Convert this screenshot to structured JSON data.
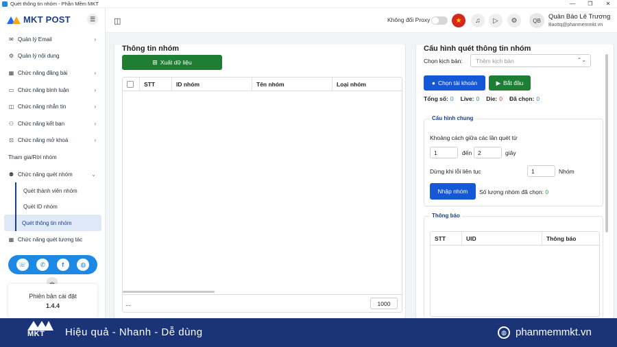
{
  "window": {
    "title": "Quét thông tin nhóm - Phần Mềm MKT",
    "minimize": "—",
    "maximize": "❐",
    "close": "✕"
  },
  "brand": {
    "logo_text": "MKT POST"
  },
  "sidebar": {
    "items": [
      {
        "label": "Quản lý Email",
        "icon": "email-icon",
        "glyph": "✉",
        "chevron": "›"
      },
      {
        "label": "Quản lý nội dung",
        "icon": "content-icon",
        "glyph": "⚙",
        "chevron": ""
      },
      {
        "label": "Chức năng đăng bài",
        "icon": "post-icon",
        "glyph": "▦",
        "chevron": "›"
      },
      {
        "label": "Chức năng bình luận",
        "icon": "comment-icon",
        "glyph": "▭",
        "chevron": "›"
      },
      {
        "label": "Chức năng nhắn tin",
        "icon": "message-icon",
        "glyph": "◫",
        "chevron": "›"
      },
      {
        "label": "Chức năng kết bạn",
        "icon": "add-friend-icon",
        "glyph": "⚇",
        "chevron": "›"
      },
      {
        "label": "Chức năng mở khoá",
        "icon": "unlock-icon",
        "glyph": "⊡",
        "chevron": "›"
      }
    ],
    "join_leave": "Tham gia/Rời nhóm",
    "scan_group": {
      "label": "Chức năng quét nhóm",
      "glyph": "⚉",
      "chevron": "⌄"
    },
    "sub_items": [
      "Quét thành viên nhóm",
      "Quét ID nhóm",
      "Quét thông tin nhóm"
    ],
    "scan_interaction": {
      "label": "Chức năng quét tương tác",
      "glyph": "▦"
    },
    "social": [
      "☏",
      "✆",
      "f",
      "◍"
    ],
    "collapse": "︽",
    "version_label": "Phiên bản cài đặt",
    "version_value": "1.4.4"
  },
  "header": {
    "layout_icon": "◫",
    "proxy_label": "Không đổi Proxy",
    "flag": "★",
    "bell": "♫",
    "play": "▷",
    "gear": "⚙",
    "avatar": "QB",
    "user_name": "Quân Bảo Lê Trương",
    "user_email": "Baottq@phanmemmkt.vn"
  },
  "left_panel": {
    "title": "Thông tin nhóm",
    "export_label": "Xuất dữ liệu",
    "export_icon": "⊞",
    "columns": [
      "STT",
      "ID nhóm",
      "Tên nhóm",
      "Loại nhóm"
    ],
    "footer_dots": "...",
    "page_size": "1000"
  },
  "right_panel": {
    "title": "Cấu hình quét thông tin nhóm",
    "script_label": "Chọn kịch bản:",
    "script_placeholder": "Thêm kịch bản",
    "select_arrow": "⌃⌄",
    "choose_account": "Chọn tài khoản",
    "start": "Bắt đầu",
    "stats": {
      "total_label": "Tổng số:",
      "total": "0",
      "live_label": "Live:",
      "live": "0",
      "die_label": "Die:",
      "die": "0",
      "selected_label": "Đã chọn:",
      "selected": "0"
    },
    "general": {
      "legend": "Cấu hình chung",
      "interval_label": "Khoảng cách giữa các lần quét từ",
      "from": "1",
      "to_label": "đến",
      "to": "2",
      "unit": "giây",
      "stop_label": "Dừng khi lỗi liên tục",
      "stop_value": "1",
      "stop_unit": "Nhóm",
      "import_btn": "Nhập nhóm",
      "selected_count_label": "Số lượng nhóm đã chọn:",
      "selected_count": "0"
    },
    "notice": {
      "legend": "Thông báo",
      "columns": [
        "STT",
        "UID",
        "Thông báo"
      ]
    }
  },
  "banner": {
    "logo": "MKT",
    "slogan": "Hiệu quả - Nhanh - Dễ dùng",
    "site": "phanmemmkt.vn"
  },
  "colors": {
    "brand_blue": "#1a3e8c",
    "primary": "#1558d6",
    "success": "#1e7e34",
    "banner": "#1b3478",
    "count_blue": "#1e88e5",
    "count_red": "#e53935",
    "count_green": "#2e9d3a"
  }
}
